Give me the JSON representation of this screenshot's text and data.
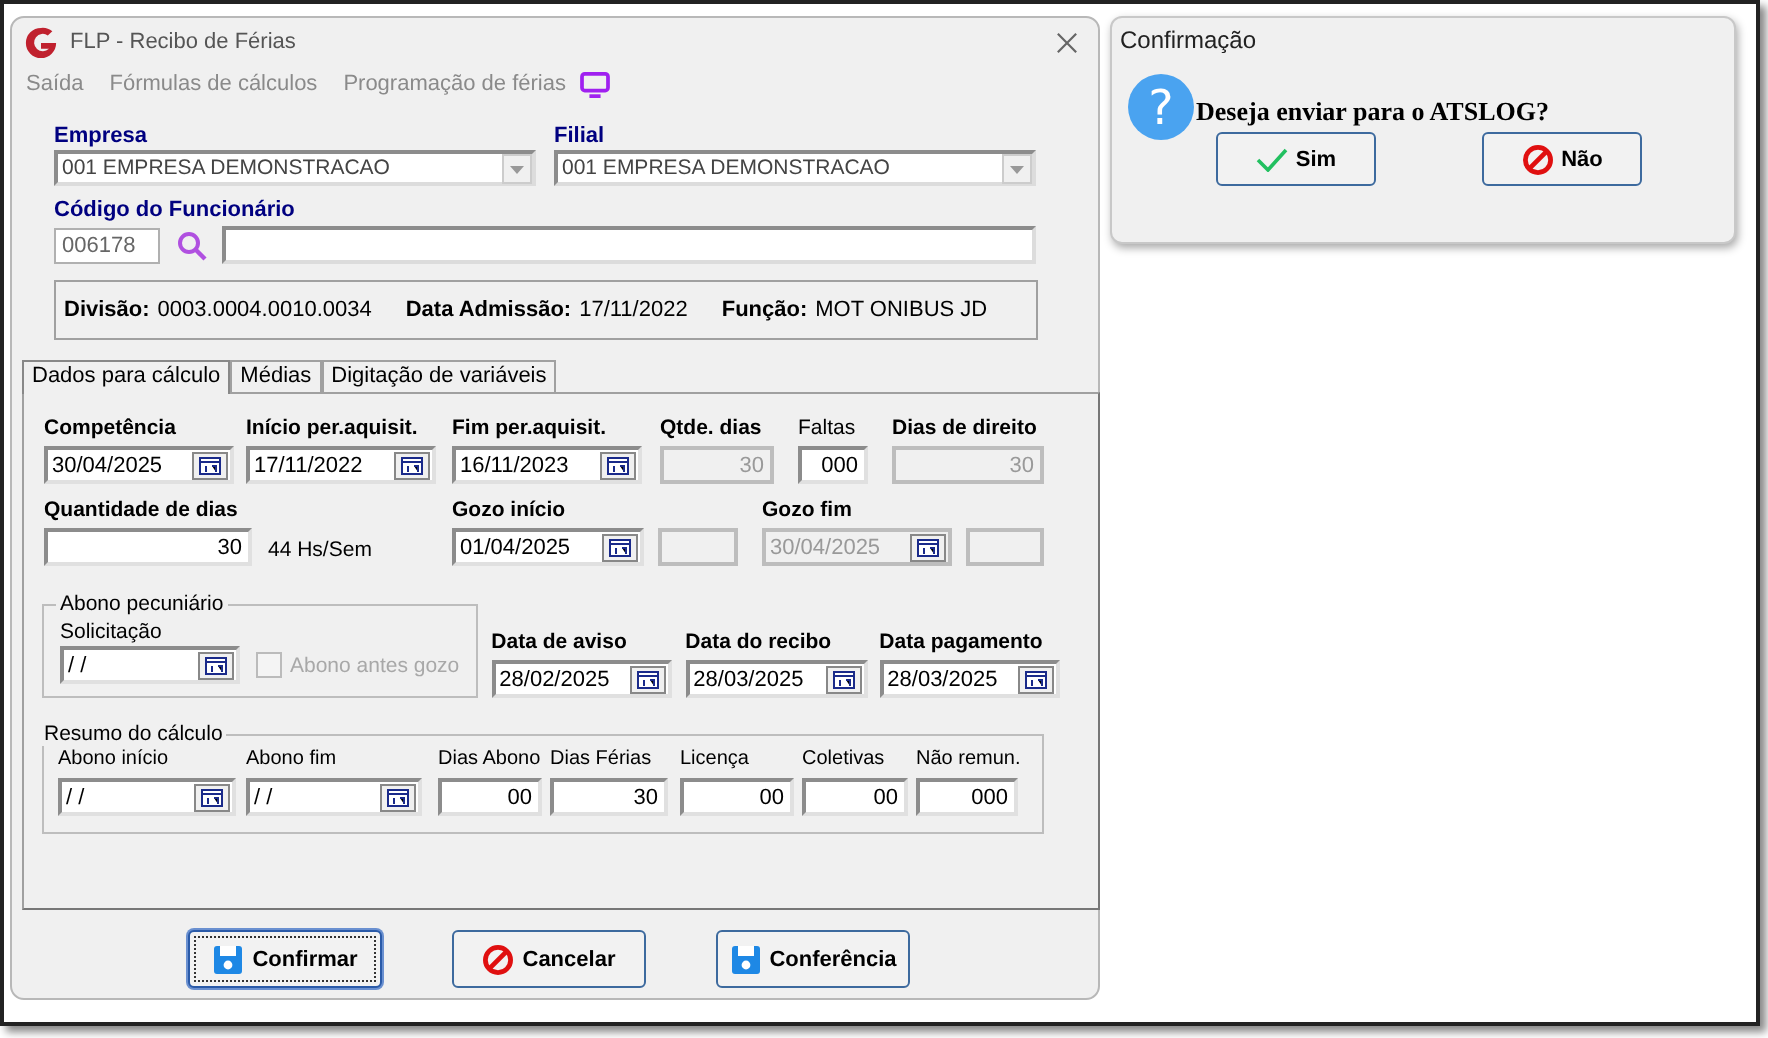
{
  "window": {
    "title": "FLP - Recibo de Férias"
  },
  "menu": [
    {
      "label": "Saída"
    },
    {
      "label": "Fórmulas de cálculos"
    },
    {
      "label": "Programação de férias"
    }
  ],
  "empresa": {
    "label": "Empresa",
    "value": "001 EMPRESA DEMONSTRACAO"
  },
  "filial": {
    "label": "Filial",
    "value": "001 EMPRESA DEMONSTRACAO"
  },
  "funcionario": {
    "label": "Código do Funcionário",
    "code": "006178"
  },
  "info": [
    {
      "label": "Divisão:",
      "value": "0003.0004.0010.0034"
    },
    {
      "label": "Data Admissão:",
      "value": "17/11/2022"
    },
    {
      "label": "Função:",
      "value": "MOT ONIBUS JD"
    }
  ],
  "tabs": [
    {
      "label": "Dados para cálculo",
      "selected": true
    },
    {
      "label": "Médias",
      "selected": false
    },
    {
      "label": "Digitação de variáveis",
      "selected": false
    }
  ],
  "calc_rows": [
    [
      {
        "kind": "date",
        "label": "Competência",
        "bold": true,
        "value": "30/04/2025",
        "disabled": false
      },
      {
        "kind": "date",
        "label": "Início per.aquisit.",
        "bold": true,
        "value": "17/11/2022",
        "disabled": false
      },
      {
        "kind": "date",
        "label": "Fim per.aquisit.",
        "bold": true,
        "value": "16/11/2023",
        "disabled": false
      },
      {
        "kind": "number",
        "label": "Qtde. dias",
        "bold": true,
        "value": "30",
        "disabled": true
      },
      {
        "kind": "number",
        "label": "Faltas",
        "bold": false,
        "value": "000",
        "disabled": false
      },
      {
        "kind": "number",
        "label": "Dias de direito",
        "bold": true,
        "value": "30",
        "disabled": true
      }
    ],
    [
      {
        "kind": "number",
        "label": "Quantidade de dias",
        "bold": true,
        "value": "30",
        "disabled": false,
        "note": "44 Hs/Sem"
      },
      {
        "kind": "date",
        "label": "Gozo início",
        "bold": true,
        "value": "01/04/2025",
        "disabled": false
      },
      {
        "kind": "blank",
        "disabled": true
      },
      {
        "kind": "date",
        "label": "Gozo fim",
        "bold": true,
        "value": "30/04/2025",
        "disabled": true
      },
      {
        "kind": "blank",
        "disabled": true
      }
    ]
  ],
  "abono": {
    "title": "Abono pecuniário",
    "field": {
      "kind": "date",
      "label": "Solicitação",
      "bold": false,
      "value": "/ /",
      "disabled": false
    },
    "checkbox": {
      "label": "Abono antes gozo",
      "checked": false,
      "disabled": true
    }
  },
  "dates": [
    {
      "kind": "date",
      "label": "Data de aviso",
      "bold": true,
      "value": "28/02/2025",
      "disabled": false
    },
    {
      "kind": "date",
      "label": "Data do recibo",
      "bold": true,
      "value": "28/03/2025",
      "disabled": false
    },
    {
      "kind": "date",
      "label": "Data pagamento",
      "bold": true,
      "value": "28/03/2025",
      "disabled": false
    }
  ],
  "resumo": {
    "title": "Resumo do cálculo",
    "fields": [
      {
        "kind": "date",
        "label": "Abono início",
        "bold": false,
        "value": "/ /",
        "disabled": false
      },
      {
        "kind": "date",
        "label": "Abono fim",
        "bold": false,
        "value": "/ /",
        "disabled": false
      },
      {
        "kind": "number",
        "label": "Dias Abono",
        "bold": false,
        "value": "00",
        "disabled": false
      },
      {
        "kind": "number",
        "label": "Dias Férias",
        "bold": false,
        "value": "30",
        "disabled": false
      },
      {
        "kind": "number",
        "label": "Licença",
        "bold": false,
        "value": "00",
        "disabled": false
      },
      {
        "kind": "number",
        "label": "Coletivas",
        "bold": false,
        "value": "00",
        "disabled": false
      },
      {
        "kind": "number",
        "label": "Não remun.",
        "bold": false,
        "value": "000",
        "disabled": false
      }
    ]
  },
  "buttons": [
    {
      "label": "Confirmar",
      "kind": "save",
      "focused": true
    },
    {
      "label": "Cancelar",
      "kind": "cancel",
      "focused": false
    },
    {
      "label": "Conferência",
      "kind": "save",
      "focused": false
    }
  ],
  "dialog": {
    "title": "Confirmação",
    "icon": "?",
    "message": "Deseja enviar para o ATSLOG?",
    "buttons": [
      {
        "label": "Sim",
        "kind": "check"
      },
      {
        "label": "Não",
        "kind": "no"
      }
    ]
  }
}
